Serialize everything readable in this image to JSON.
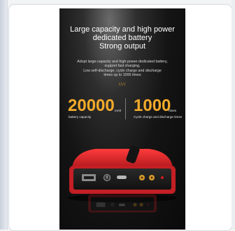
{
  "banner": {
    "title_lines": [
      "Large capacity and high power",
      "dedicated battery",
      "Strong output"
    ],
    "desc_lines": [
      "Adopt large-capacity and high-power dedicated battery,",
      "support fast charging,",
      "Low self-discharge, cycle charge and discharge",
      "times up to 1000 times"
    ],
    "mark": "////",
    "stat1": {
      "value": "20000",
      "unit": "mAh",
      "label": "battery capacity"
    },
    "stat2": {
      "value": "1000",
      "unit": "Times",
      "label": "Cycle charge and discharge times"
    }
  },
  "colors": {
    "accent": "#f3aa2a",
    "device_red": "#d1232a",
    "background": "#0f0f0f"
  },
  "icons": [
    "usb-port-icon",
    "power-button-icon",
    "usb-c-port-icon",
    "jump-starter-terminals-icon"
  ]
}
